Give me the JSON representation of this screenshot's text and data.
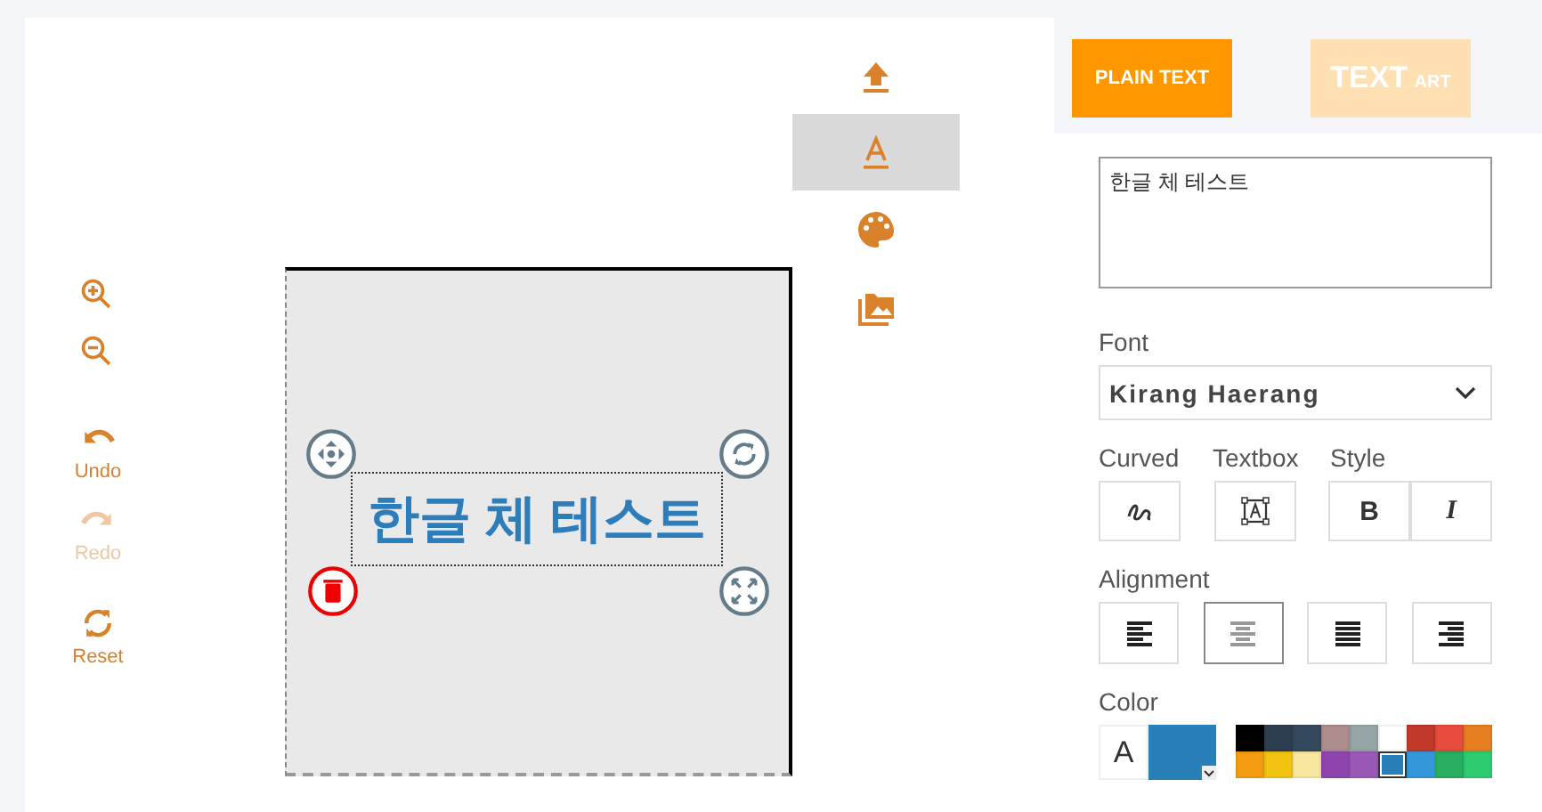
{
  "left_tools": [
    {
      "kind": "zoom_in",
      "disabled": false
    },
    {
      "kind": "zoom_out",
      "disabled": false
    },
    {
      "kind": "undo",
      "label": "Undo",
      "disabled": false
    },
    {
      "kind": "redo",
      "label": "Redo",
      "disabled": true
    },
    {
      "kind": "reset",
      "label": "Reset",
      "disabled": false
    }
  ],
  "canvas": {
    "text": "한글 체 테스트",
    "color": "#2e7dbb",
    "handles": [
      {
        "kind": "move"
      },
      {
        "kind": "rotate"
      },
      {
        "kind": "delete"
      },
      {
        "kind": "resize"
      }
    ]
  },
  "side_tools": [
    {
      "kind": "upload",
      "selected": false
    },
    {
      "kind": "text",
      "selected": true
    },
    {
      "kind": "palette",
      "selected": false
    },
    {
      "kind": "images",
      "selected": false
    }
  ],
  "tabs": [
    {
      "label": "PLAIN TEXT",
      "kind": "plain",
      "selected": true
    },
    {
      "label": "TEXT",
      "label_small": "ART",
      "kind": "art",
      "selected": false
    }
  ],
  "text_input": {
    "value": "한글 체 테스트"
  },
  "font": {
    "label": "Font",
    "value": "Kirang Haerang"
  },
  "options": {
    "curved_label": "Curved",
    "textbox_label": "Textbox",
    "style_label": "Style",
    "bold": "B",
    "italic": "I"
  },
  "alignment": {
    "label": "Alignment",
    "buttons": [
      {
        "kind": "left",
        "selected": false
      },
      {
        "kind": "center",
        "selected": true
      },
      {
        "kind": "justify",
        "selected": false
      },
      {
        "kind": "right",
        "selected": false
      }
    ]
  },
  "color": {
    "label": "Color",
    "sample": "A",
    "current": {
      "color": "#2980b9"
    },
    "swatches": [
      {
        "color": "#000000",
        "selected": false
      },
      {
        "color": "#2c3e50",
        "selected": false
      },
      {
        "color": "#34495e",
        "selected": false
      },
      {
        "color": "#ad8c8c",
        "selected": false
      },
      {
        "color": "#95a5a6",
        "selected": false
      },
      {
        "color": "#ffffff",
        "selected": false
      },
      {
        "color": "#c0392b",
        "selected": false
      },
      {
        "color": "#e74c3c",
        "selected": false
      },
      {
        "color": "#e67e22",
        "selected": false
      },
      {
        "color": "#f39c12",
        "selected": false
      },
      {
        "color": "#f1c40f",
        "selected": false
      },
      {
        "color": "#f9e79f",
        "selected": false
      },
      {
        "color": "#8e44ad",
        "selected": false
      },
      {
        "color": "#9b59b6",
        "selected": false
      },
      {
        "color": "#2980b9",
        "selected": true
      },
      {
        "color": "#3498db",
        "selected": false
      },
      {
        "color": "#27ae60",
        "selected": false
      },
      {
        "color": "#2ecc71",
        "selected": false
      }
    ]
  }
}
